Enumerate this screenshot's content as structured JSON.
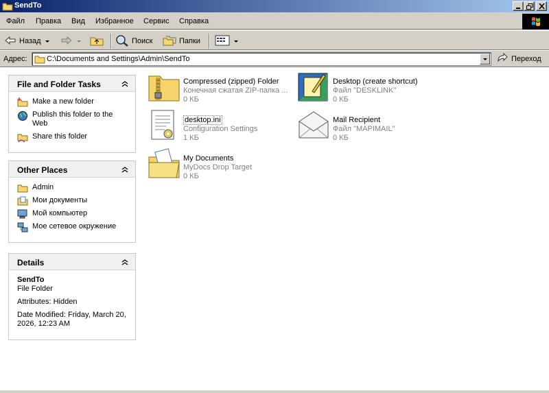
{
  "window": {
    "title": "SendTo"
  },
  "menu": [
    "Файл",
    "Правка",
    "Вид",
    "Избранное",
    "Сервис",
    "Справка"
  ],
  "toolbar": {
    "back": "Назад",
    "search": "Поиск",
    "folders": "Папки"
  },
  "address": {
    "label": "Адрес:",
    "value": "C:\\Documents and Settings\\Admin\\SendTo",
    "go": "Переход"
  },
  "panels": {
    "tasks": {
      "title": "File and Folder Tasks",
      "items": [
        "Make a new folder",
        "Publish this folder to the Web",
        "Share this folder"
      ]
    },
    "places": {
      "title": "Other Places",
      "items": [
        "Admin",
        "Мои документы",
        "Мой компьютер",
        "Мое сетевое окружение"
      ]
    },
    "details": {
      "title": "Details",
      "name": "SendTo",
      "type": "File Folder",
      "attributes": "Attributes: Hidden",
      "modified": "Date Modified: Friday, March 20, 2026, 12:23 AM"
    }
  },
  "files": [
    {
      "name": "Compressed (zipped) Folder",
      "desc": "Конечная сжатая ZIP-папка ...",
      "size": "0 КБ",
      "icon": "zip-folder-icon"
    },
    {
      "name": "Desktop (create shortcut)",
      "desc": "Файл \"DESKLINK\"",
      "size": "0 КБ",
      "icon": "desktop-shortcut-icon"
    },
    {
      "name": "desktop.ini",
      "desc": "Configuration Settings",
      "size": "1 КБ",
      "icon": "settings-file-icon"
    },
    {
      "name": "Mail Recipient",
      "desc": "Файл \"MAPIMAIL\"",
      "size": "0 КБ",
      "icon": "envelope-icon"
    },
    {
      "name": "My Documents",
      "desc": "MyDocs Drop Target",
      "size": "0 КБ",
      "icon": "my-documents-folder-icon"
    }
  ]
}
